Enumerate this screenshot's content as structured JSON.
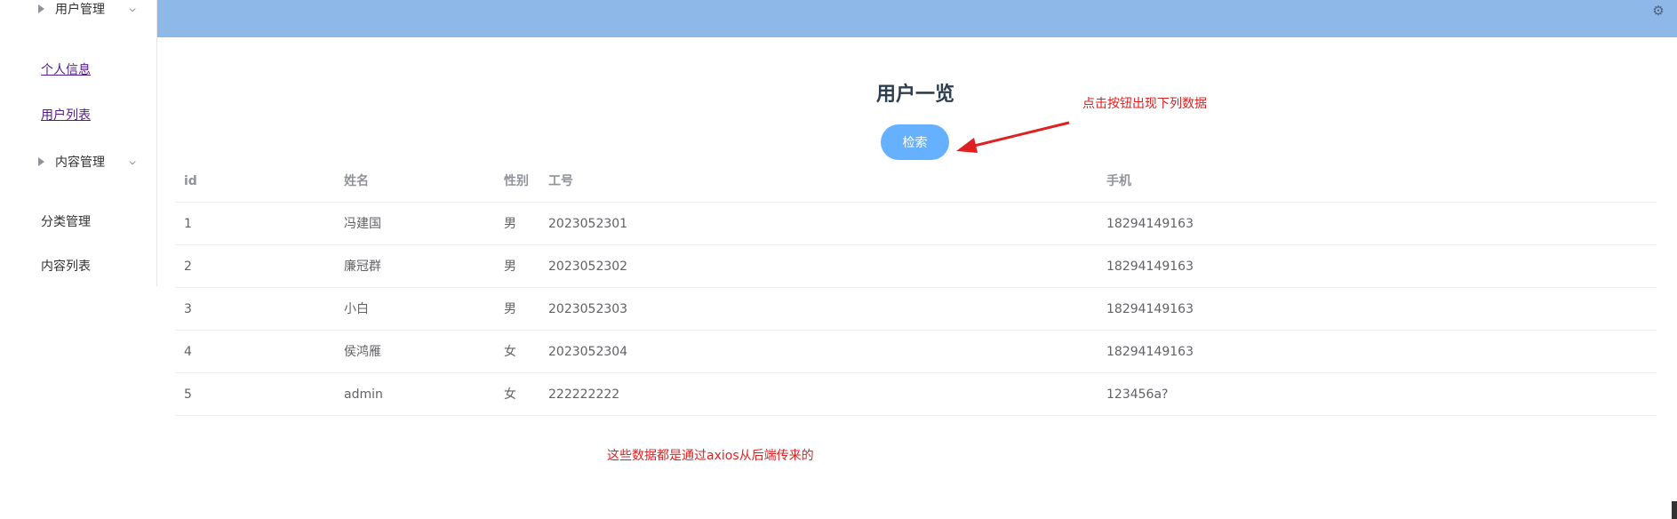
{
  "sidebar": {
    "groups": [
      {
        "label": "用户管理",
        "items": [
          "个人信息",
          "用户列表"
        ]
      },
      {
        "label": "内容管理",
        "items": [
          "分类管理",
          "内容列表"
        ]
      }
    ],
    "chevron": "^"
  },
  "header": {
    "settings_icon": "gear-icon",
    "settings_glyph": "⚙",
    "bg_color": "#8db8e8"
  },
  "main": {
    "title": "用户一览",
    "search_button": "检索",
    "annotation_top": "点击按钮出现下列数据",
    "annotation_bottom": "这些数据都是通过axios从后端传来的"
  },
  "table": {
    "columns": [
      "id",
      "姓名",
      "性别",
      "工号",
      "手机"
    ],
    "rows": [
      [
        "1",
        "冯建国",
        "男",
        "2023052301",
        "18294149163"
      ],
      [
        "2",
        "廉冠群",
        "男",
        "2023052302",
        "18294149163"
      ],
      [
        "3",
        "小白",
        "男",
        "2023052303",
        "18294149163"
      ],
      [
        "4",
        "侯鸿雁",
        "女",
        "2023052304",
        "18294149163"
      ],
      [
        "5",
        "admin",
        "女",
        "222222222",
        "123456a?"
      ]
    ]
  },
  "colors": {
    "accent": "#66b1ff",
    "annotation": "#e02020"
  }
}
